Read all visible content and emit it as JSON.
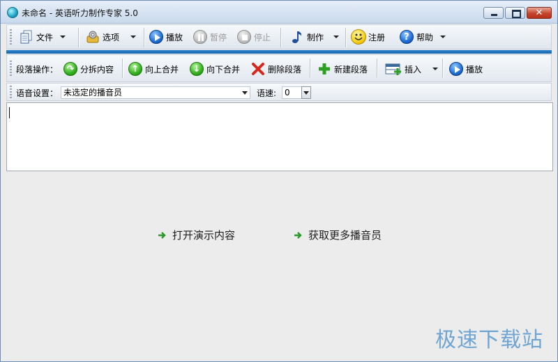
{
  "window": {
    "title": "未命名 - 英语听力制作专家 5.0",
    "close_glyph": "✕"
  },
  "main_toolbar": {
    "file": "文件",
    "options": "选项",
    "play": "播放",
    "pause": "暂停",
    "stop": "停止",
    "make": "制作",
    "register": "注册",
    "help": "帮助"
  },
  "paragraph_toolbar": {
    "label": "段落操作：",
    "split": "分拆内容",
    "merge_up": "向上合并",
    "merge_down": "向下合并",
    "delete": "删除段落",
    "new": "新建段落",
    "insert": "插入",
    "play": "播放"
  },
  "voice_bar": {
    "voice_label": "语音设置：",
    "voice_value": "未选定的播音员",
    "speed_label": "语速:",
    "speed_value": "0"
  },
  "lower_panel": {
    "open_demo": "打开演示内容",
    "get_more_voices": "获取更多播音员"
  },
  "watermark": "极速下载站",
  "colors": {
    "accent_blue": "#1567b0",
    "watermark": "#6fa5d3",
    "link_arrow": "#2b9a2b"
  }
}
